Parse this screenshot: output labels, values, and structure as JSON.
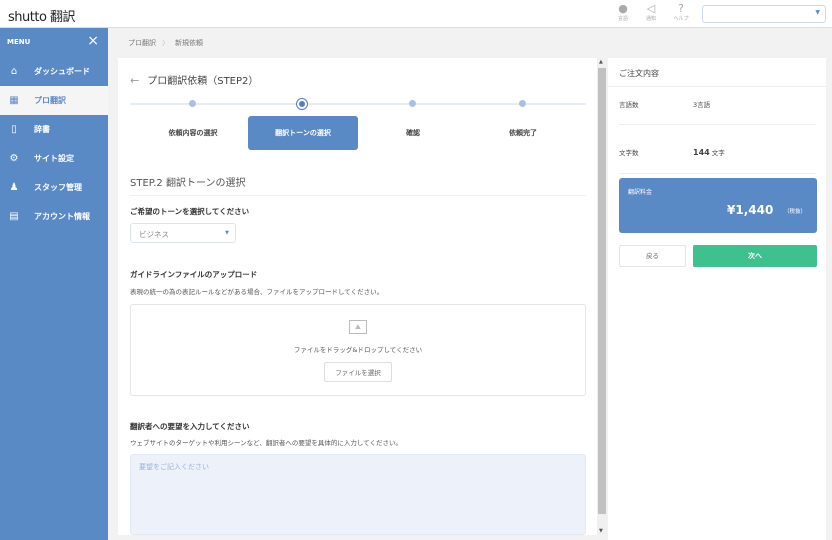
{
  "header": {
    "logo": "shutto 翻訳",
    "icons": [
      {
        "name": "globe-icon",
        "label": "言語",
        "glyph": "●"
      },
      {
        "name": "bell-icon",
        "label": "通知",
        "glyph": "◁"
      },
      {
        "name": "help-icon",
        "label": "ヘルプ",
        "glyph": "?"
      }
    ],
    "select_value": ""
  },
  "sidebar": {
    "menu_label": "MENU",
    "close": "×",
    "items": [
      {
        "label": "ダッシュボード",
        "icon": "⌂"
      },
      {
        "label": "プロ翻訳",
        "icon": "▦"
      },
      {
        "label": "辞書",
        "icon": "▯"
      },
      {
        "label": "サイト設定",
        "icon": "⚙"
      },
      {
        "label": "スタッフ管理",
        "icon": "♟"
      },
      {
        "label": "アカウント情報",
        "icon": "▤"
      }
    ]
  },
  "breadcrumb": {
    "items": [
      "プロ翻訳",
      "新規依頼"
    ],
    "sep": "〉"
  },
  "main": {
    "back": "←",
    "title": "プロ翻訳依頼（STEP2）",
    "steps": [
      "依頼内容の選択",
      "翻訳トーンの選択",
      "確認",
      "依頼完了"
    ],
    "active_step": 2,
    "section_title": "STEP.2 翻訳トーンの選択",
    "tone_label": "ご希望のトーンを選択してください",
    "tone_value": "ビジネス",
    "upload_label": "ガイドラインファイルのアップロード",
    "upload_desc": "表現の統一の為の表記ルールなどがある場合、ファイルをアップロードしてください。",
    "drop_text": "ファイルをドラッグ&ドロップしてください",
    "file_button": "ファイルを選択",
    "request_label": "翻訳者への要望を入力してください",
    "request_desc": "ウェブサイトのターゲットや利用シーンなど、翻訳者への要望を具体的に入力してください。",
    "request_placeholder": "要望をご記入ください"
  },
  "order": {
    "title": "ご注文内容",
    "lang_label": "言語数",
    "lang_value": "3言語",
    "chars_label": "文字数",
    "chars_value": "144",
    "chars_unit": "文字",
    "fee_label": "翻訳料金",
    "fee": "¥1,440",
    "tax": "（税抜）",
    "back": "戻る",
    "next": "次へ"
  },
  "colors": {
    "primary": "#5a8ac6",
    "success": "#3fc18f"
  }
}
